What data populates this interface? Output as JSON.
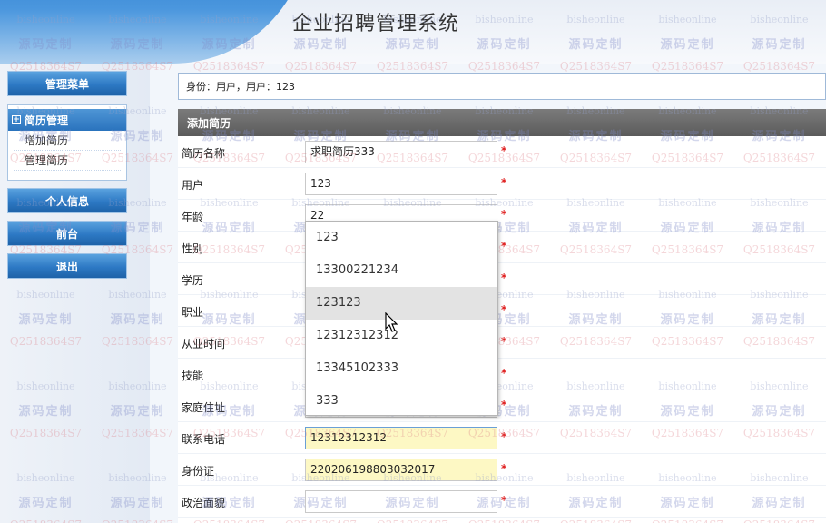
{
  "app_title": "企业招聘管理系统",
  "sidebar": {
    "admin_menu": "管理菜单",
    "resume_section": {
      "label": "简历管理",
      "links": [
        "增加简历",
        "管理简历"
      ]
    },
    "personal_info": "个人信息",
    "front_page": "前台",
    "logout": "退出"
  },
  "identity_text": "身份：用户，用户：123",
  "form_title": "添加简历",
  "fields": [
    {
      "label": "简历名称",
      "value": "求职简历333"
    },
    {
      "label": "用户",
      "value": "123"
    },
    {
      "label": "年龄",
      "value": "22"
    },
    {
      "label": "性别",
      "value": ""
    },
    {
      "label": "学历",
      "value": ""
    },
    {
      "label": "职业",
      "value": ""
    },
    {
      "label": "从业时间",
      "value": ""
    },
    {
      "label": "技能",
      "value": ""
    },
    {
      "label": "家庭住址",
      "value": ""
    },
    {
      "label": "联系电话",
      "value": "12312312312"
    },
    {
      "label": "身份证",
      "value": "220206198803032017"
    },
    {
      "label": "政治面貌",
      "value": ""
    }
  ],
  "required_mark": "*",
  "autocomplete_options": [
    "123",
    "13300221234",
    "123123",
    "12312312312",
    "13345102333",
    "333"
  ],
  "watermark": {
    "a": "bisheonline",
    "b": "源码定制",
    "c": "Q2518364S7"
  }
}
